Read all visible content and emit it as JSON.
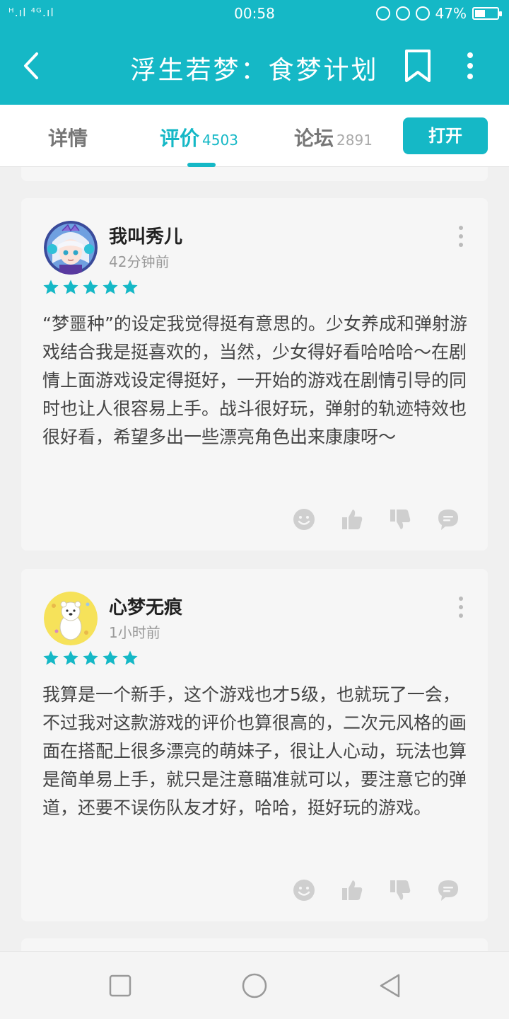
{
  "status_bar": {
    "signal": "ᴴ.ıl ⁴ᴳ.ıl",
    "time": "00:58",
    "battery_percent": "47%",
    "battery_level": 0.47
  },
  "app_bar": {
    "title": "浮生若梦：食梦计划",
    "back_icon": "back-arrow-icon",
    "bookmark_icon": "bookmark-icon",
    "more_icon": "more-vertical-icon"
  },
  "tabs": [
    {
      "label": "详情",
      "count": ""
    },
    {
      "label": "评价",
      "count": "4503"
    },
    {
      "label": "论坛",
      "count": "2891"
    }
  ],
  "open_button": "打开",
  "colors": {
    "accent": "#15b8c6",
    "star": "#15b8c6",
    "action_icon": "#cfcfcf"
  },
  "reviews": [
    {
      "username": "我叫秀儿",
      "time_ago": "42分钟前",
      "rating": 5,
      "text": "“梦噩种”的设定我觉得挺有意思的。少女养成和弹射游戏结合我是挺喜欢的，当然，少女得好看哈哈哈～在剧情上面游戏设定得挺好，一开始的游戏在剧情引导的同时也让人很容易上手。战斗很好玩，弹射的轨迹特效也很好看，希望多出一些漂亮角色出来康康呀～",
      "avatar": "anime-girl-avatar"
    },
    {
      "username": "心梦无痕",
      "time_ago": "1小时前",
      "rating": 5,
      "text": "我算是一个新手，这个游戏也才5级，也就玩了一会，不过我对这款游戏的评价也算很高的，二次元风格的画面在搭配上很多漂亮的萌妹子，很让人心动，玩法也算是简单易上手，就只是注意瞄准就可以，要注意它的弹道，还要不误伤队友才好，哈哈，挺好玩的游戏。",
      "avatar": "polar-bear-avatar"
    }
  ],
  "review_actions": [
    "smile-icon",
    "thumbs-up-icon",
    "thumbs-down-icon",
    "comment-icon"
  ],
  "nav_bar": [
    "recent-apps-icon",
    "home-icon",
    "back-triangle-icon"
  ]
}
